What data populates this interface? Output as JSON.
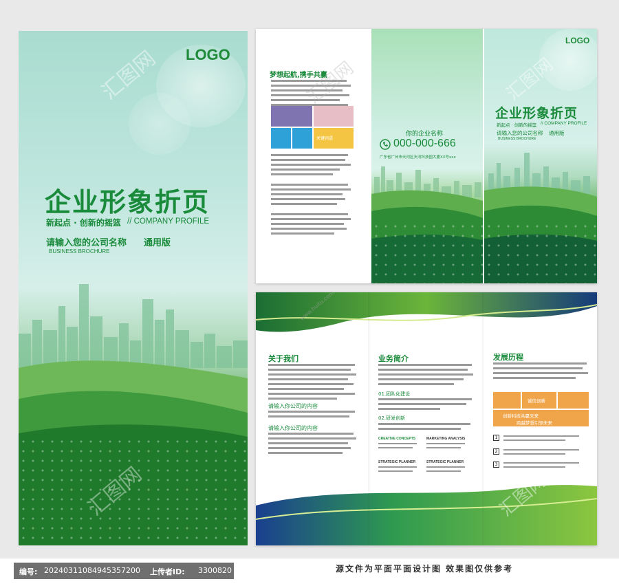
{
  "cover": {
    "logo": "LOGO",
    "title": "企业形象折页",
    "subtitle_cn": "新起点 · 创新的摇篮",
    "subtitle_en": "// COMPANY PROFILE",
    "company_prompt": "请输入您的公司名称",
    "edition": "通用版",
    "brochure_en": "BUSINESS BROCHURE"
  },
  "top_spread": {
    "heading": "梦想起航,携手共赢",
    "logo": "LOGO",
    "contact_label": "你的企业名称",
    "phone": "000-000-666",
    "address": "广东省广州市天河区天河科技园大厦XX号xxx",
    "title": "企业形象折页",
    "subtitle_cn": "新起点 · 创新的摇篮",
    "subtitle_en": "// COMPANY PROFILE",
    "company_prompt": "请输入您的公司名称",
    "edition": "通用版",
    "brochure_en": "BUSINESS BROCHURE",
    "tile_label": "关键词语"
  },
  "bottom_spread": {
    "about_title": "关于我们",
    "about_input_1": "请输入你公司的内容",
    "about_input_2": "请输入你公司的内容",
    "business_title": "业务简介",
    "business_sub_1": "01.团队化建设",
    "business_sub_2": "02.研发创新",
    "grid": [
      {
        "title": "CREATIVE CONCEPTS"
      },
      {
        "title": "MARKETING ANALYSIS"
      },
      {
        "title": "STRATEGIC PLANNER"
      },
      {
        "title": "STRATEGIC PLANNER"
      }
    ],
    "history_title": "发展历程",
    "history_box_1": "诚信创新",
    "history_box_2": "创新科技共赢未来",
    "history_box_3": "跨越梦想引领未来",
    "history_steps": [
      "1",
      "2",
      "3"
    ]
  },
  "watermark": "汇图网",
  "watermark_url": "www.huitu.com",
  "footer": {
    "id_label": "编号:",
    "id_value": "20240311084945357200",
    "uploader_label": "上传者ID:",
    "uploader_value": "3300820",
    "notice": "源文件为平面平面设计图 效果图仅供参考"
  },
  "colors": {
    "brand_green": "#1a8a3b",
    "orange": "#f0a54a",
    "sky": "#bfe6de"
  }
}
